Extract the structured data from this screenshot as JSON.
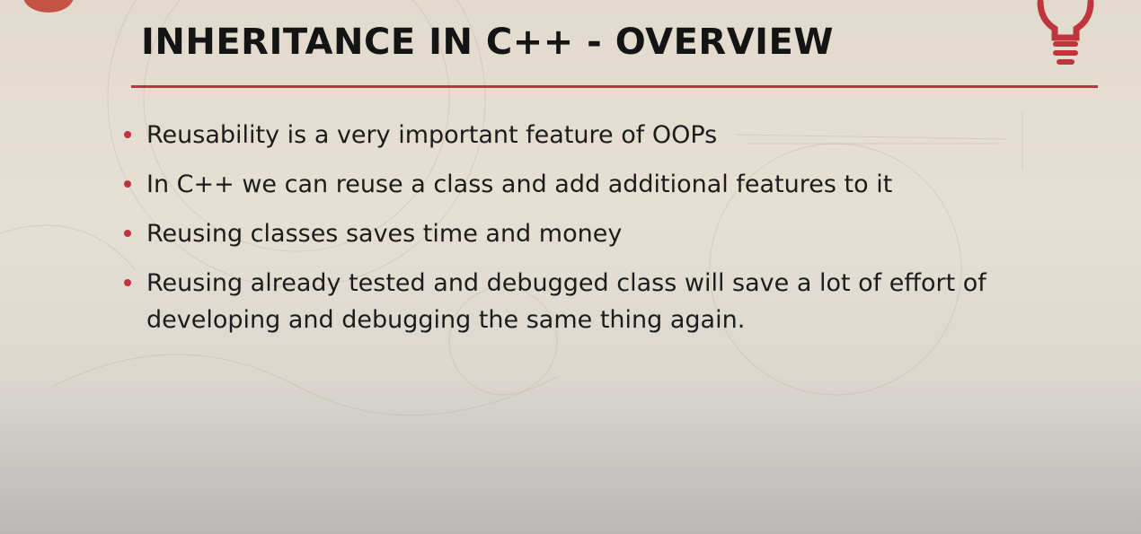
{
  "slide": {
    "title": "INHERITANCE IN C++ - OVERVIEW",
    "icon": "lightbulb-icon",
    "accent_color": "#c0343b",
    "bullets": [
      {
        "text": "Reusability is a very important feature of OOPs"
      },
      {
        "text": "In C++ we can reuse a class and add additional features to it"
      },
      {
        "text": "Reusing classes saves time and money"
      },
      {
        "text": "Reusing already tested and debugged class will save a lot of effort of developing and debugging the same thing again."
      }
    ]
  }
}
